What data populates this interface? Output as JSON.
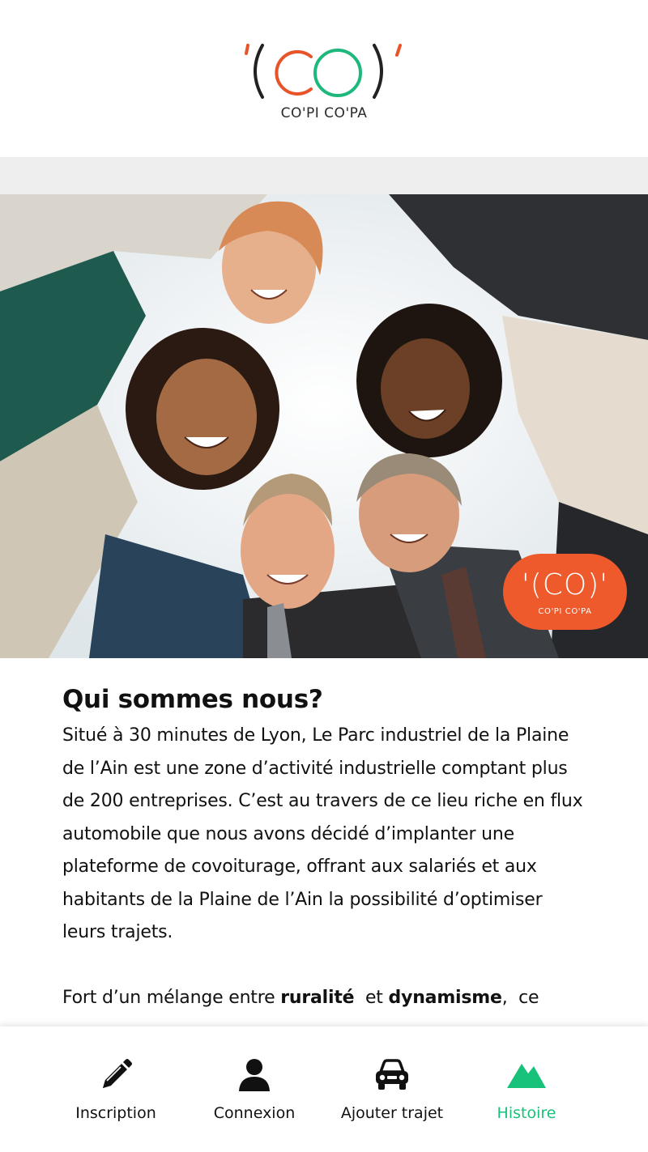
{
  "app": {
    "logo_mark": "'(CO)'",
    "brand_name": "CO'PI CO'PA",
    "colors": {
      "accent_orange": "#ee5a2b",
      "accent_green": "#19c27a",
      "logo_red": "#e8532a",
      "logo_green": "#1fb87c"
    }
  },
  "hero": {
    "image": "people-circle-looking-down-photo",
    "badge_mark": "'(CO)'",
    "badge_name": "CO'PI CO'PA"
  },
  "article": {
    "title": "Qui sommes nous?",
    "paragraph1": "Situé à 30 minutes de Lyon, Le Parc industriel de la Plaine de l’Ain est une zone d’activité industrielle comptant plus de 200 entreprises. C’est au travers de ce lieu riche en flux automobile que nous avons décidé d’implanter une plateforme de covoiturage, offrant aux salariés et aux habitants de la Plaine de l’Ain la possibilité d’optimiser leurs trajets.",
    "paragraph2_start": "Fort d’un mélange entre ",
    "paragraph2_bold1": "ruralité",
    "paragraph2_mid": "  et ",
    "paragraph2_bold2": "dynamisme",
    "paragraph2_end": ",  ce"
  },
  "bottom_nav": {
    "items": [
      {
        "label": "Inscription",
        "icon": "pencil-icon"
      },
      {
        "label": "Connexion",
        "icon": "user-icon"
      },
      {
        "label": "Ajouter trajet",
        "icon": "car-icon"
      },
      {
        "label": "Histoire",
        "icon": "mountain-icon",
        "active": true
      }
    ]
  }
}
